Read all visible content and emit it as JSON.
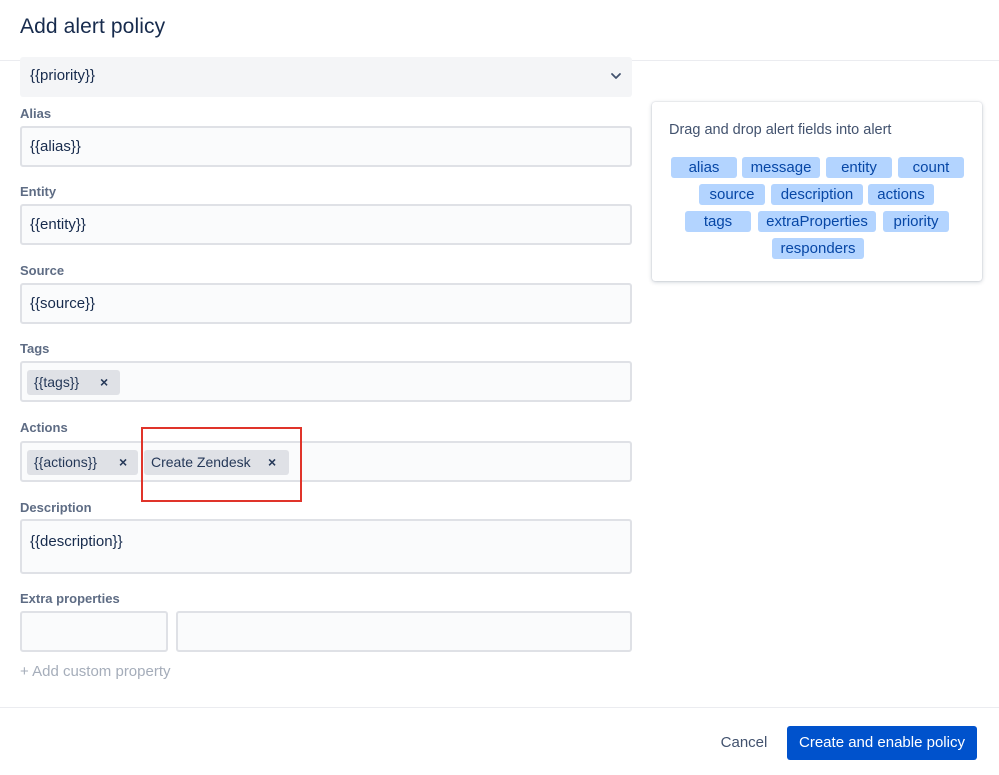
{
  "dialog": {
    "title": "Add alert policy"
  },
  "priority": {
    "value": "{{priority}}",
    "icon": "chevron-down-icon"
  },
  "alias": {
    "label": "Alias",
    "value": "{{alias}}"
  },
  "entity": {
    "label": "Entity",
    "value": "{{entity}}"
  },
  "source": {
    "label": "Source",
    "value": "{{source}}"
  },
  "tags": {
    "label": "Tags",
    "chips": [
      {
        "text": "{{tags}}",
        "remove": "×"
      }
    ]
  },
  "actions": {
    "label": "Actions",
    "chips": [
      {
        "text": "{{actions}}",
        "remove": "×"
      },
      {
        "text": "Create Zendesk",
        "remove": "×"
      }
    ],
    "highlight_color": "#e0342a"
  },
  "description": {
    "label": "Description",
    "value": "{{description}}"
  },
  "extra_properties": {
    "label": "Extra properties",
    "key": "",
    "value": "",
    "add_link": "+ Add custom property"
  },
  "fields_panel": {
    "hint": "Drag and drop alert fields into alert",
    "tags": [
      "alias",
      "message",
      "entity",
      "count",
      "source",
      "description",
      "actions",
      "tags",
      "extraProperties",
      "priority",
      "responders"
    ]
  },
  "footer": {
    "cancel_label": "Cancel",
    "submit_label": "Create and enable policy"
  },
  "colors": {
    "primary": "#0052cc",
    "tag_bg": "#b3d4ff",
    "tag_text": "#0747a6"
  }
}
